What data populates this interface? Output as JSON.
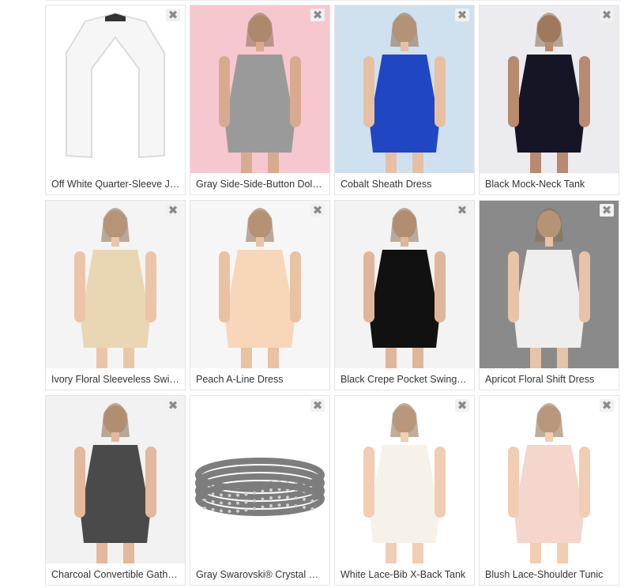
{
  "remove_glyph": "✖",
  "products": [
    {
      "name": "Off White Quarter-Sleeve Jacket",
      "display": "Off White Quarter-Sleeve J…",
      "bg": "#ffffff",
      "garment": "#f6f6f6",
      "skin": "#f1d2bd",
      "icon": "blazer"
    },
    {
      "name": "Gray Side-Side-Button Dolman Top",
      "display": "Gray Side-Side-Button Dol…",
      "bg": "#f7c7d0",
      "garment": "#9a9a9a",
      "skin": "#d8ab90",
      "icon": "model"
    },
    {
      "name": "Cobalt Sheath Dress",
      "display": "Cobalt Sheath Dress",
      "bg": "#cfe1ef",
      "garment": "#2146c4",
      "skin": "#e7c0a4",
      "icon": "model"
    },
    {
      "name": "Black Mock-Neck Tank",
      "display": "Black Mock-Neck Tank",
      "bg": "#ececf0",
      "garment": "#151526",
      "skin": "#b88a6f",
      "icon": "model"
    },
    {
      "name": "Ivory Floral Sleeveless Swing Dress",
      "display": "Ivory Floral Sleeveless Swin…",
      "bg": "#f4f4f4",
      "garment": "#e9d6b4",
      "skin": "#ecc5a9",
      "icon": "model"
    },
    {
      "name": "Peach A-Line Dress",
      "display": "Peach A-Line Dress",
      "bg": "#f6f6f6",
      "garment": "#f7d6b9",
      "skin": "#e9c1a3",
      "icon": "model"
    },
    {
      "name": "Black Crepe Pocket Swing Dress",
      "display": "Black Crepe Pocket Swing …",
      "bg": "#f3f3f3",
      "garment": "#111111",
      "skin": "#e0b69b",
      "icon": "model"
    },
    {
      "name": "Apricot Floral Shift Dress",
      "display": "Apricot Floral Shift Dress",
      "bg": "#8a8a8a",
      "garment": "#eeeeee",
      "skin": "#e7c3a7",
      "icon": "model"
    },
    {
      "name": "Charcoal Convertible Gathered Top",
      "display": "Charcoal Convertible Gath…",
      "bg": "#f2f2f2",
      "garment": "#4a4a4a",
      "skin": "#e3b89c",
      "icon": "model"
    },
    {
      "name": "Gray Swarovski® Crystal & Leather Wrap Bracelet",
      "display": "Gray Swarovski® Crystal & …",
      "bg": "#ffffff",
      "garment": "#7d7d7d",
      "skin": "#d0d0d0",
      "icon": "bracelet"
    },
    {
      "name": "White Lace-Bib X-Back Tank",
      "display": "White Lace-Bib X-Back Tank",
      "bg": "#ffffff",
      "garment": "#f6f2ea",
      "skin": "#f0cdb3",
      "icon": "model"
    },
    {
      "name": "Blush Lace-Shoulder Tunic",
      "display": "Blush Lace-Shoulder Tunic",
      "bg": "#ffffff",
      "garment": "#f5d6cc",
      "skin": "#f0cdb3",
      "icon": "model"
    }
  ]
}
